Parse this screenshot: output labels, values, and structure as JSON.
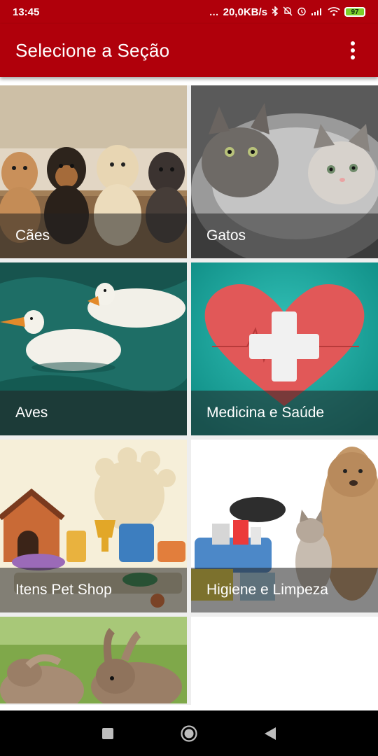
{
  "status_bar": {
    "time": "13:45",
    "network_speed": "20,0KB/s",
    "battery_level": "97",
    "icons": [
      "dots-icon",
      "bluetooth-icon",
      "mute-icon",
      "alarm-icon",
      "signal-icon",
      "wifi-icon",
      "battery-icon"
    ]
  },
  "app_bar": {
    "title": "Selecione a Seção",
    "menu_icon": "more-vert-icon"
  },
  "sections": [
    {
      "label": "Cães"
    },
    {
      "label": "Gatos"
    },
    {
      "label": "Aves"
    },
    {
      "label": "Medicina e Saúde"
    },
    {
      "label": "Itens Pet Shop"
    },
    {
      "label": "Higiene e Limpeza"
    },
    {
      "label": ""
    }
  ],
  "nav_bar": {
    "icons": [
      "recents-square-icon",
      "home-circle-icon",
      "back-triangle-icon"
    ]
  },
  "colors": {
    "primary": "#b0000b",
    "caption_overlay": "#232323",
    "teal": "#17a9a0"
  }
}
